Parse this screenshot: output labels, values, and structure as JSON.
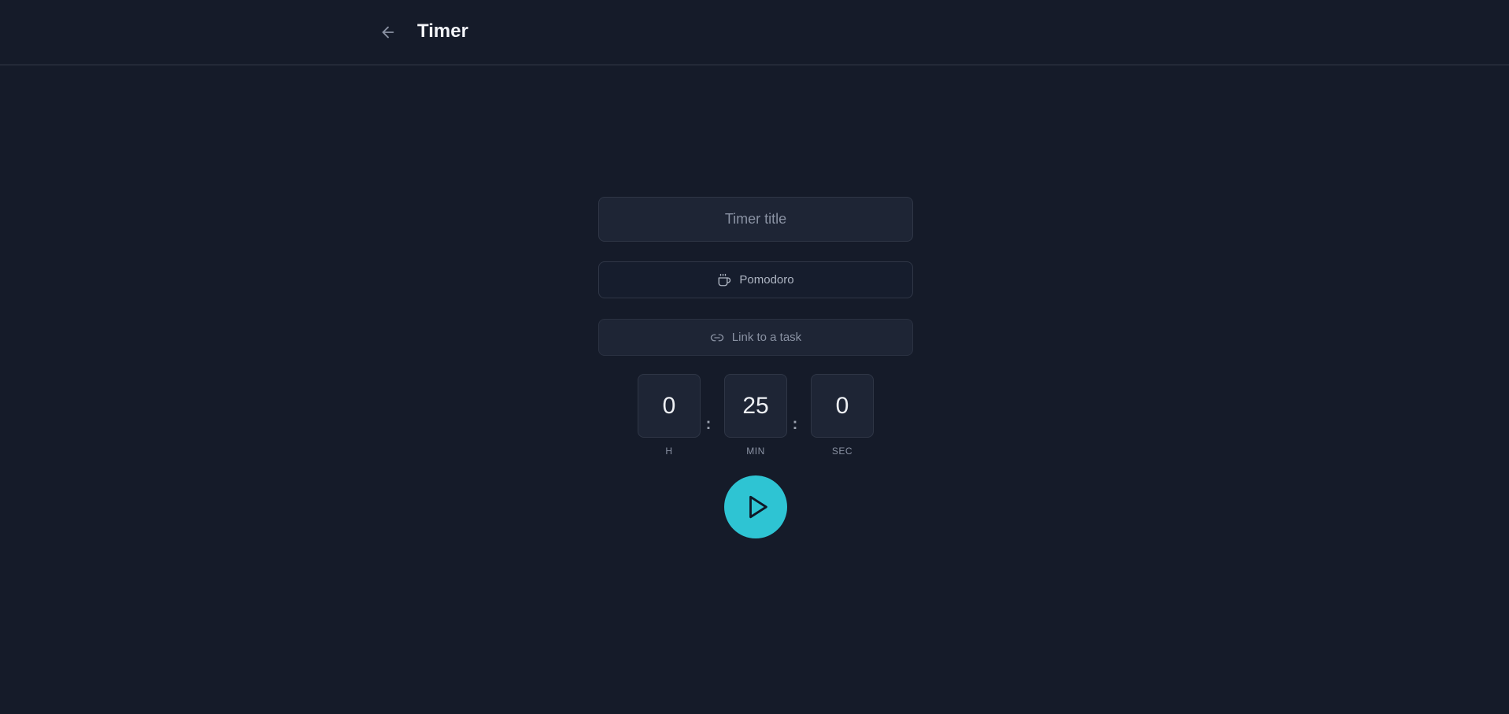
{
  "header": {
    "title": "Timer",
    "back_icon": "arrow-left-icon"
  },
  "form": {
    "title_placeholder": "Timer title",
    "title_value": "",
    "pomodoro_label": "Pomodoro",
    "pomodoro_icon": "coffee-cup-icon",
    "link_label": "Link to a task",
    "link_icon": "link-icon"
  },
  "time": {
    "hours": "0",
    "minutes": "25",
    "seconds": "0",
    "separator": ":",
    "hours_label": "H",
    "minutes_label": "MIN",
    "seconds_label": "SEC"
  },
  "controls": {
    "play_icon": "play-icon",
    "accent_color": "#2ec4d3"
  },
  "colors": {
    "background": "#151b29",
    "surface": "#1e2535",
    "border": "#2f3646"
  }
}
